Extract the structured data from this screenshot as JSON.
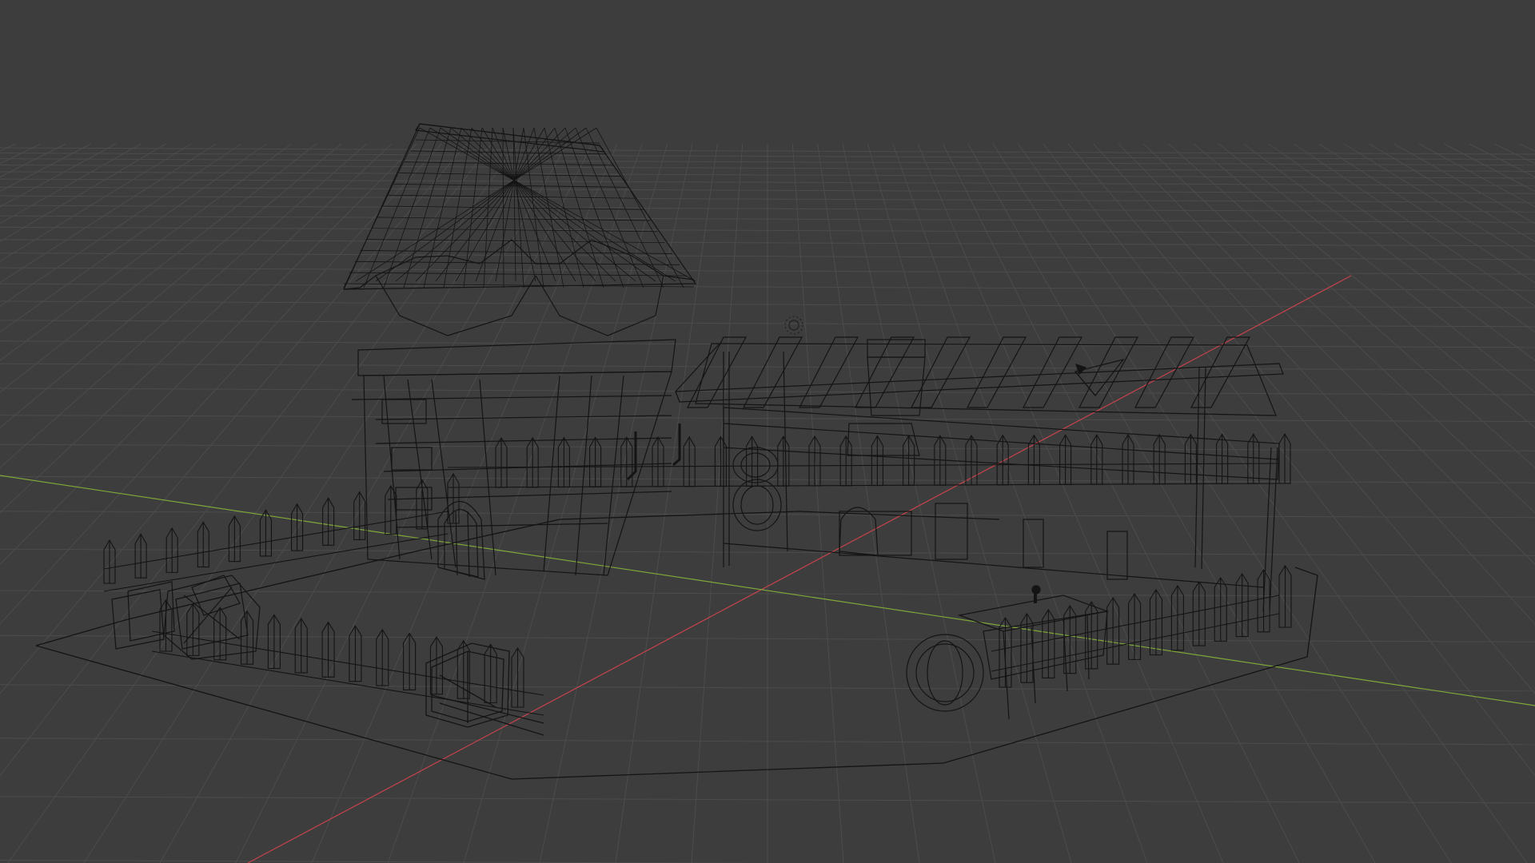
{
  "app": {
    "name": "3D Viewport"
  },
  "viewport": {
    "shading_mode": "wireframe",
    "background_color": "#3d3d3d",
    "grid_color": "#4c4c4c",
    "x_axis_color": "#c8424c",
    "y_axis_color": "#7fa83a",
    "wire_color": "#141414"
  },
  "scene": {
    "objects": [
      "tower-house",
      "pergola-shed",
      "picket-fence",
      "crates-left",
      "crate-front",
      "barrel-cart-right",
      "ground-plate",
      "light-gizmo",
      "camera-gizmo"
    ]
  }
}
